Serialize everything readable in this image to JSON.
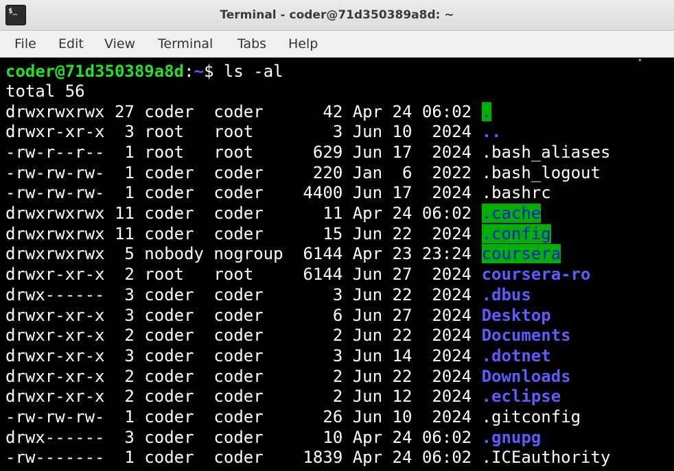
{
  "window": {
    "title": "Terminal - coder@71d350389a8d: ~",
    "icon": "terminal-icon",
    "icon_text": "$_"
  },
  "menu": [
    "File",
    "Edit",
    "View",
    "Terminal",
    "Tabs",
    "Help"
  ],
  "prompt": {
    "user_host": "coder@71d350389a8d",
    "sep": ":",
    "path": "~",
    "symbol": "$",
    "command": " ls -al"
  },
  "total": "total 56",
  "entries": [
    {
      "prefix": "drwxrwxrwx 27 coder  coder      42 Apr 24 06:02 ",
      "name": ".",
      "style": "dir-hl"
    },
    {
      "prefix": "drwxr-xr-x  3 root   root        3 Jun 10  2024 ",
      "name": "..",
      "style": "dir"
    },
    {
      "prefix": "-rw-r--r--  1 root   root      629 Jun 17  2024 ",
      "name": ".bash_aliases",
      "style": "file"
    },
    {
      "prefix": "-rw-rw-rw-  1 coder  coder     220 Jan  6  2022 ",
      "name": ".bash_logout",
      "style": "file"
    },
    {
      "prefix": "-rw-rw-rw-  1 coder  coder    4400 Jun 17  2024 ",
      "name": ".bashrc",
      "style": "file"
    },
    {
      "prefix": "drwxrwxrwx 11 coder  coder      11 Apr 24 06:02 ",
      "name": ".cache",
      "style": "dir-hl"
    },
    {
      "prefix": "drwxrwxrwx 11 coder  coder      15 Jun 22  2024 ",
      "name": ".config",
      "style": "dir-hl"
    },
    {
      "prefix": "drwxrwxrwx  5 nobody nogroup  6144 Apr 23 23:24 ",
      "name": "coursera",
      "style": "dir-hl"
    },
    {
      "prefix": "drwxr-xr-x  2 root   root     6144 Jun 27  2024 ",
      "name": "coursera-ro",
      "style": "dir"
    },
    {
      "prefix": "drwx------  3 coder  coder       3 Jun 22  2024 ",
      "name": ".dbus",
      "style": "dir"
    },
    {
      "prefix": "drwxr-xr-x  3 coder  coder       6 Jun 27  2024 ",
      "name": "Desktop",
      "style": "dir"
    },
    {
      "prefix": "drwxr-xr-x  2 coder  coder       2 Jun 22  2024 ",
      "name": "Documents",
      "style": "dir"
    },
    {
      "prefix": "drwxr-xr-x  3 coder  coder       3 Jun 14  2024 ",
      "name": ".dotnet",
      "style": "dir"
    },
    {
      "prefix": "drwxr-xr-x  2 coder  coder       2 Jun 22  2024 ",
      "name": "Downloads",
      "style": "dir"
    },
    {
      "prefix": "drwxr-xr-x  2 coder  coder       2 Jun 12  2024 ",
      "name": ".eclipse",
      "style": "dir"
    },
    {
      "prefix": "-rw-rw-rw-  1 coder  coder      26 Jun 10  2024 ",
      "name": ".gitconfig",
      "style": "file"
    },
    {
      "prefix": "drwx------  3 coder  coder      10 Apr 24 06:02 ",
      "name": ".gnupg",
      "style": "dir"
    },
    {
      "prefix": "-rw-------  1 coder  coder    1839 Apr 24 06:02 ",
      "name": ".ICEauthority",
      "style": "file"
    }
  ],
  "colors": {
    "prompt_user": "#26e026",
    "directory": "#5c5cff",
    "highlight_bg": "#00b000",
    "highlight_fg": "#1b1bd4",
    "text": "#ffffff",
    "background": "#000000"
  }
}
